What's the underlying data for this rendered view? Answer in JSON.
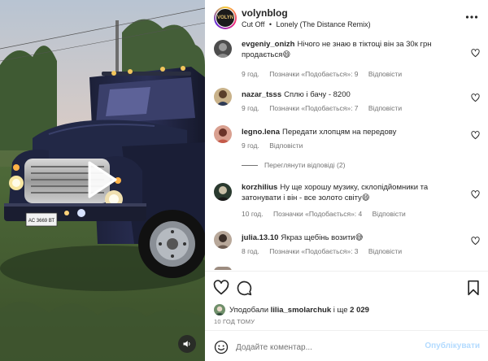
{
  "post": {
    "author": "volynblog",
    "audio_artist": "Cut Off",
    "audio_separator": "•",
    "audio_track": "Lonely (The Distance Remix)",
    "avatar_text": "VOLYN"
  },
  "video": {
    "plate": "АС 3669 ВТ"
  },
  "comments": [
    {
      "username": "evgeniy_onizh",
      "text": "Нічого не знаю в тіктоці він за 30к грн продається😄",
      "time": "9 год.",
      "likes": "Позначки «Подобається»: 9",
      "reply": "Відповісти",
      "avatar_color": "#6b6b6b"
    },
    {
      "username": "nazar_tsss",
      "text": "Сплю і бачу - 8200",
      "time": "9 год.",
      "likes": "Позначки «Подобається»: 7",
      "reply": "Відповісти",
      "avatar_color": "#8b7a5a"
    },
    {
      "username": "legno.lena",
      "text": "Передати хлопцям на передову",
      "time": "9 год.",
      "reply": "Відповісти",
      "view_replies": "Переглянути відповіді (2)",
      "avatar_color": "#a05a4a"
    },
    {
      "username": "korzhilius",
      "text": "Ну ще хорошу музику, склопідйомники та затонувати і він - все золото світу😄",
      "time": "10 год.",
      "likes": "Позначки «Подобається»: 4",
      "reply": "Відповісти",
      "avatar_color": "#3b4a3b"
    },
    {
      "username": "julia.13.10",
      "text": "Якраз щебінь возити😅",
      "time": "8 год.",
      "likes": "Позначки «Подобається»: 3",
      "reply": "Відповісти",
      "avatar_color": "#7a6a60"
    }
  ],
  "likes_summary": {
    "prefix": "Уподобали",
    "user": "lilia_smolarchuk",
    "middle": "і ще",
    "count": "2 029"
  },
  "post_time": "10 ГОД ТОМУ",
  "comment_box": {
    "placeholder": "Додайте коментар...",
    "publish_label": "Опублікувати"
  },
  "colors": {
    "link_disabled": "#b3dbff",
    "meta_gray": "#737373"
  }
}
